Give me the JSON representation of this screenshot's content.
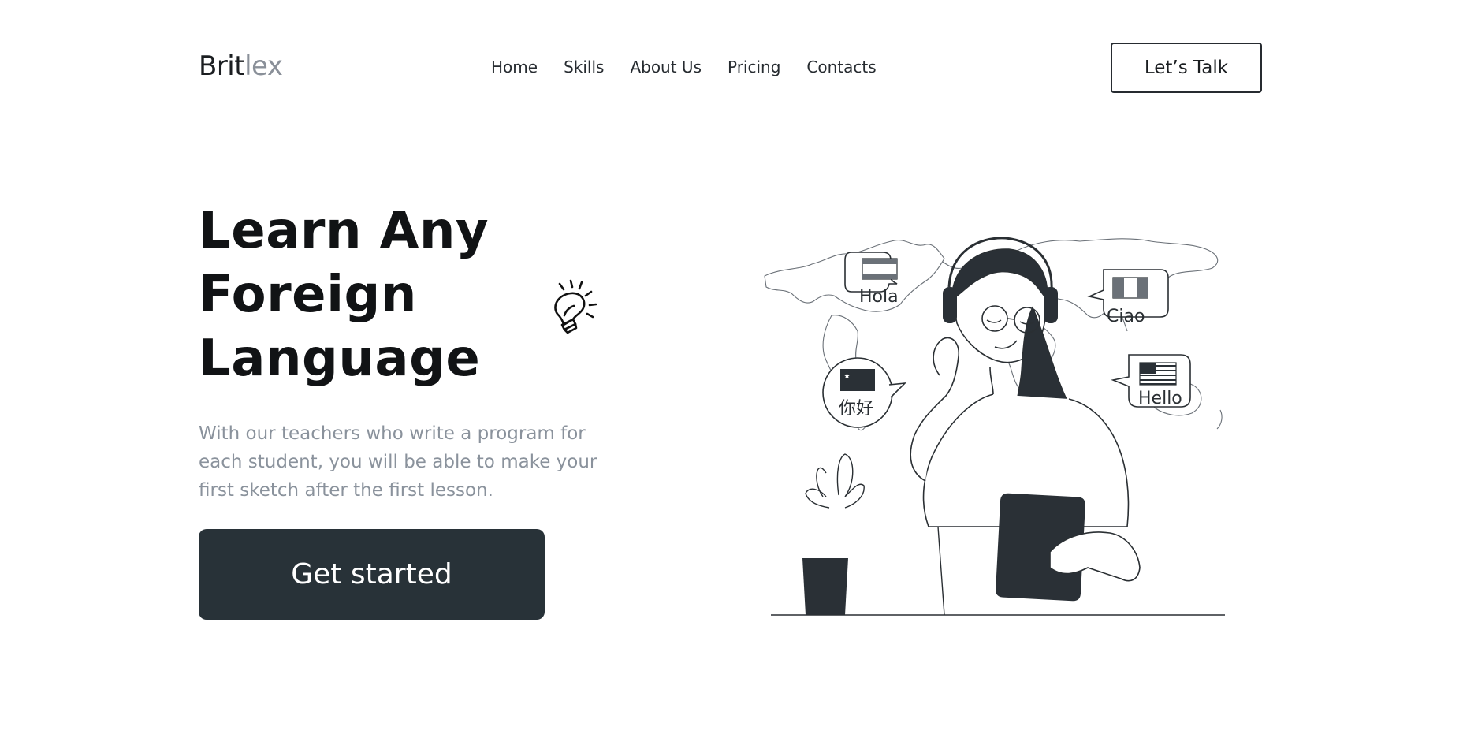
{
  "header": {
    "logo_dark": "Brit",
    "logo_light": "lex",
    "nav": [
      "Home",
      "Skills",
      "About Us",
      "Pricing",
      "Contacts"
    ],
    "cta_label": "Let’s Talk"
  },
  "hero": {
    "title_lines": [
      "Learn Any",
      "Foreign",
      "Language"
    ],
    "subtitle": "With our teachers who write a program for each student, you will be able to make your first sketch after the first lesson.",
    "button_label": "Get started"
  },
  "illustration": {
    "bubbles": [
      "Hola",
      "Ciao",
      "你好",
      "Hello"
    ]
  },
  "colors": {
    "button_bg": "#283238",
    "muted_text": "#8a929c",
    "logo_light": "#8a9099"
  }
}
